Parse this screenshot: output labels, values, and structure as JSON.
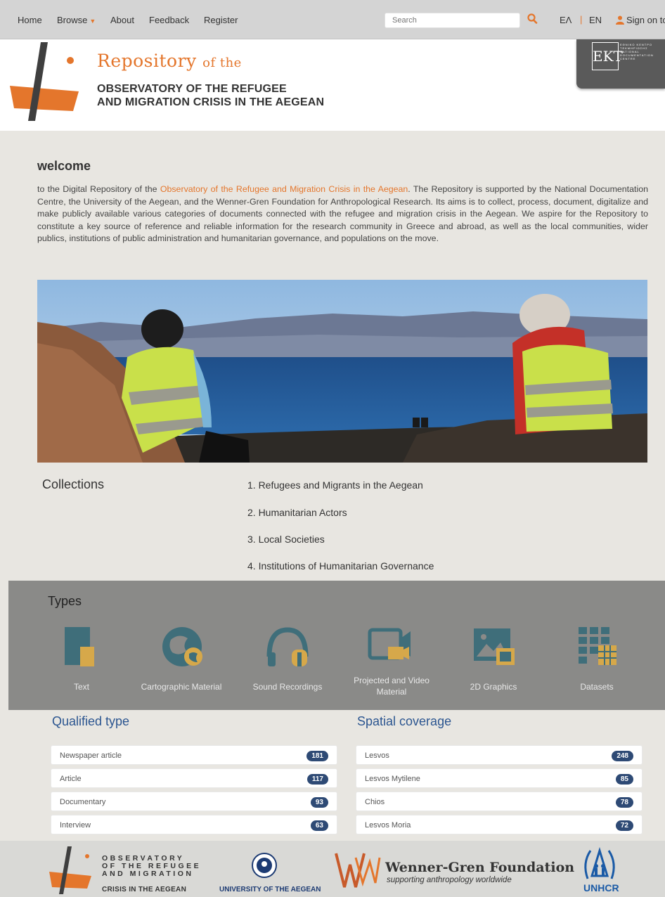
{
  "nav": {
    "home": "Home",
    "browse": "Browse",
    "about": "About",
    "feedback": "Feedback",
    "register": "Register",
    "search_placeholder": "Search",
    "lang_el": "ΕΛ",
    "lang_en": "EN",
    "sign_on": "Sign on to"
  },
  "header": {
    "repo_title": "Repository",
    "repo_title_suffix": "of the",
    "org_line1": "OBSERVATORY OF THE REFUGEE",
    "org_line2": "AND MIGRATION CRISIS IN THE AEGEAN",
    "ekt_mark": "EKT",
    "ekt_lines": [
      "ΕΘΝΙΚΟ ΚΕΝΤΡΟ",
      "ΤΕΚΜΗΡΙΩΣΗΣ",
      "NATIONAL",
      "DOCUMENTATION",
      "CENTRE"
    ]
  },
  "welcome": {
    "title": "welcome",
    "text_before": "to the Digital Repository of the ",
    "link": "Observatory of the Refugee and Migration Crisis in the Aegean",
    "text_after": ". The Repository is supported by the National Documentation Centre, the University of the Aegean, and the Wenner-Gren Foundation for Anthropological Research. Its aims is to collect, process, document, digitalize and make publicly available various categories of documents connected with the refugee and migration crisis in the Aegean. We aspire for the Repository to constitute a key source of reference and reliable information for the research community in Greece and abroad, as well as the local communities, wider publics, institutions of public administration and humanitarian governance, and populations on the move."
  },
  "collections": {
    "title": "Collections",
    "items": [
      "1. Refugees and Migrants in the Aegean",
      "2. Humanitarian Actors",
      "3. Local Societies",
      "4. Institutions of Humanitarian Governance"
    ]
  },
  "types": {
    "title": "Types",
    "items": [
      {
        "label": "Text",
        "icon": "book-icon"
      },
      {
        "label": "Cartographic Material",
        "icon": "globe-icon"
      },
      {
        "label": "Sound Recordings",
        "icon": "headphones-icon"
      },
      {
        "label": "Projected and Video Material",
        "icon": "video-camera-icon"
      },
      {
        "label": "2D Graphics",
        "icon": "image-icon"
      },
      {
        "label": "Datasets",
        "icon": "grid-icon"
      }
    ]
  },
  "qualified_type": {
    "title": "Qualified type",
    "rows": [
      {
        "label": "Newspaper article",
        "count": "181"
      },
      {
        "label": "Article",
        "count": "117"
      },
      {
        "label": "Documentary",
        "count": "93"
      },
      {
        "label": "Interview",
        "count": "63"
      }
    ]
  },
  "spatial_coverage": {
    "title": "Spatial coverage",
    "rows": [
      {
        "label": "Lesvos",
        "count": "248"
      },
      {
        "label": "Lesvos Mytilene",
        "count": "85"
      },
      {
        "label": "Chios",
        "count": "78"
      },
      {
        "label": "Lesvos Moria",
        "count": "72"
      }
    ]
  },
  "footer": {
    "observatory_lines": [
      "OBSERVATORY",
      "OF THE REFUGEE",
      "AND MIGRATION"
    ],
    "observatory_sub": "CRISIS IN THE AEGEAN",
    "university": "UNIVERSITY OF THE AEGEAN",
    "wg_name": "Wenner-Gren Foundation",
    "wg_tagline": "supporting anthropology worldwide",
    "unhcr": "UNHCR"
  },
  "colors": {
    "accent": "#e4762c",
    "badge": "#2e4a75",
    "facet_title": "#2b5590",
    "icon_teal": "#3f6e7a",
    "icon_gold": "#d6a84a"
  }
}
